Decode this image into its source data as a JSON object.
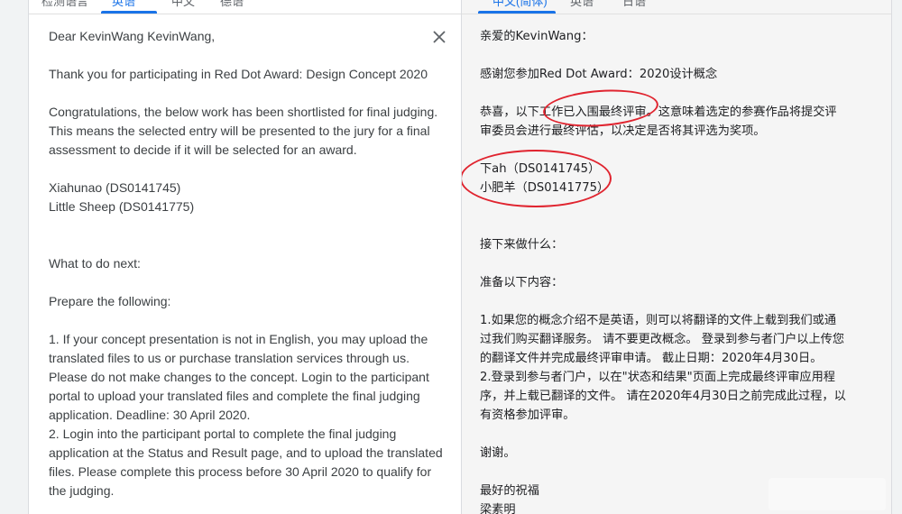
{
  "tabs_left": [
    {
      "label": "检测语言",
      "active": false
    },
    {
      "label": "英语",
      "active": true
    },
    {
      "label": "中文",
      "active": false
    },
    {
      "label": "德语",
      "active": false
    }
  ],
  "tabs_right": [
    {
      "label": "中文(简体)",
      "active": true
    },
    {
      "label": "英语",
      "active": false
    },
    {
      "label": "日语",
      "active": false
    }
  ],
  "source": {
    "greeting": "Dear KevinWang KevinWang,",
    "thanks": "Thank you for participating in Red Dot Award: Design Concept 2020",
    "congrats": "Congratulations, the below work has been shortlisted for final judging.\nThis means the selected entry will be presented to the jury for a final\nassessment to decide if it will be selected for an award.",
    "works": "Xiahunao (DS0141745)\nLittle Sheep (DS0141775)",
    "next": "What to do next:",
    "prepare": "Prepare the following:",
    "steps": "1. If your concept presentation is not in English, you may upload the\ntranslated files to us or purchase translation services through us.\nPlease do not make changes to the concept. Login to the participant\nportal to upload your translated files and complete the final judging\napplication. Deadline: 30 April 2020.\n2. Login into the participant portal to complete the final judging\napplication at the Status and Result page, and to upload the translated\nfiles. Please complete this process before 30 April 2020 to qualify for\nthe judging."
  },
  "translation": {
    "greeting": "亲爱的KevinWang：",
    "thanks": "感谢您参加Red Dot Award：2020设计概念",
    "congrats": "恭喜，以下工作已入围最终评审。这意味着选定的参赛作品将提交评\n审委员会进行最终评估，以决定是否将其评选为奖项。",
    "works": "下ah（DS0141745）\n小肥羊（DS0141775）",
    "next": "接下来做什么：",
    "prepare": "准备以下内容：",
    "steps": "1.如果您的概念介绍不是英语，则可以将翻译的文件上载到我们或通\n过我们购买翻译服务。 请不要更改概念。 登录到参与者门户以上传您\n的翻译文件并完成最终评审申请。 截止日期：2020年4月30日。\n2.登录到参与者门户，以在\"状态和结果\"页面上完成最终评审应用程\n序，并上载已翻译的文件。 请在2020年4月30日之前完成此过程，以\n有资格参加评审。",
    "thanks_short": "谢谢。",
    "regards": "最好的祝福",
    "signature": "梁素明"
  },
  "colors": {
    "accent": "#1a73e8",
    "annotation": "#e0242f"
  },
  "icons": {
    "close": "close-icon"
  }
}
